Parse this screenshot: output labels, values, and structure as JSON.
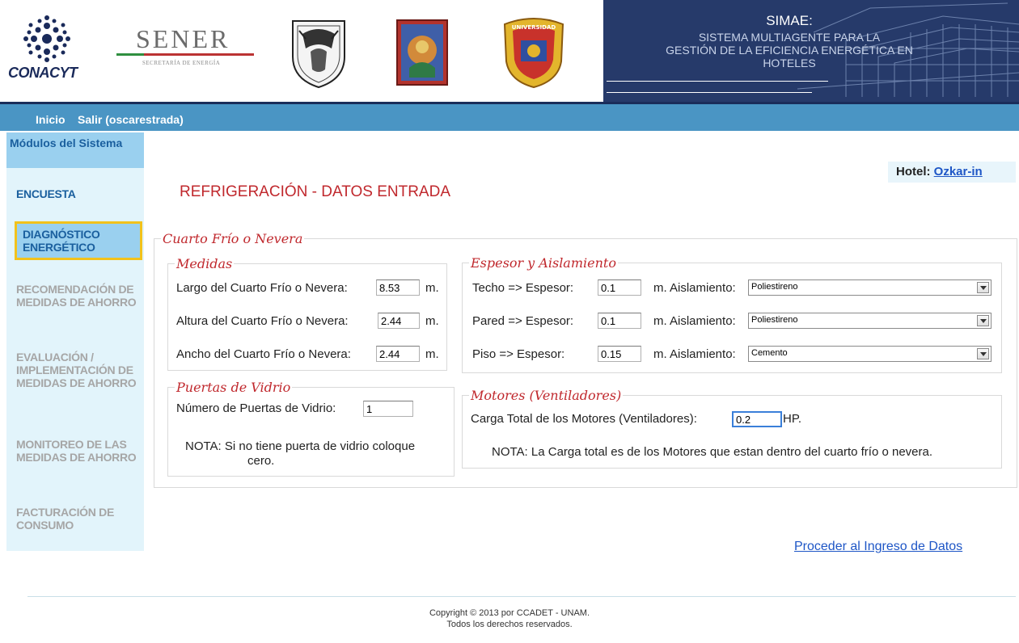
{
  "header": {
    "logos": {
      "conacyt": "CONACYT",
      "sener_title": "SENER",
      "sener_subtitle": "SECRETARÍA DE ENERGÍA"
    },
    "banner_title": "SIMAE:",
    "banner_subtitle_1": "SISTEMA MULTIAGENTE PARA LA",
    "banner_subtitle_2": "GESTIÓN DE LA EFICIENCIA ENERGÉTICA EN",
    "banner_subtitle_3": "HOTELES"
  },
  "nav": {
    "home": "Inicio",
    "logout": "Salir (oscarestrada)"
  },
  "sidebar": {
    "heading": "Módulos del Sistema",
    "items": [
      {
        "label": "ENCUESTA"
      },
      {
        "label": "DIAGNÓSTICO ENERGÉTICO"
      },
      {
        "label": "RECOMENDACIÓN DE MEDIDAS DE AHORRO"
      },
      {
        "label": "EVALUACIÓN / IMPLEMENTACIÓN DE MEDIDAS DE AHORRO"
      },
      {
        "label": "MONITOREO DE LAS MEDIDAS DE AHORRO"
      },
      {
        "label": "FACTURACIÓN DE CONSUMO"
      }
    ]
  },
  "hotel": {
    "label": "Hotel:",
    "name": "Ozkar-in"
  },
  "page_title": "REFRIGERACIÓN - DATOS ENTRADA",
  "form": {
    "outer_legend": "Cuarto Frío o Nevera",
    "medidas": {
      "legend": "Medidas",
      "rows": [
        {
          "label": "Largo del Cuarto Frío o Nevera:",
          "value": "8.53",
          "unit": "m."
        },
        {
          "label": "Altura del Cuarto Frío o Nevera:",
          "value": "2.44",
          "unit": "m."
        },
        {
          "label": "Ancho del Cuarto Frío o Nevera:",
          "value": "2.44",
          "unit": "m."
        }
      ]
    },
    "espesor": {
      "legend": "Espesor y Aislamiento",
      "rows": [
        {
          "label": "Techo  =>  Espesor:",
          "value": "0.1",
          "unit": "m.",
          "insul_label": "Aislamiento:",
          "insul_value": "Poliestireno"
        },
        {
          "label": "Pared  =>  Espesor:",
          "value": "0.1",
          "unit": "m.",
          "insul_label": "Aislamiento:",
          "insul_value": "Poliestireno"
        },
        {
          "label": "Piso     => Espesor:",
          "value": "0.15",
          "unit": "m.",
          "insul_label": "Aislamiento:",
          "insul_value": "Cemento"
        }
      ]
    },
    "puertas": {
      "legend": "Puertas de Vidrio",
      "label": "Número de Puertas de Vidrio:",
      "value": "1",
      "note_line1": "NOTA: Si no tiene puerta de vidrio coloque",
      "note_line2": "cero."
    },
    "motores": {
      "legend": "Motores (Ventiladores)",
      "label": "Carga Total de los Motores (Ventiladores):",
      "value": "0.2",
      "unit": "HP.",
      "note": "NOTA: La Carga total es de los Motores que estan dentro del cuarto frío o nevera."
    }
  },
  "proceed_link": "Proceder al Ingreso de Datos",
  "footer": {
    "line1": "Copyright © 2013 por CCADET - UNAM.",
    "line2": "Todos los derechos reservados."
  },
  "colors": {
    "banner": "#263a6a",
    "nav": "#4a95c4",
    "accent_red": "#c0282d",
    "link_blue": "#1e56c6",
    "sidebar_bg": "#e2f4fb",
    "highlight": "#f2c21b"
  }
}
